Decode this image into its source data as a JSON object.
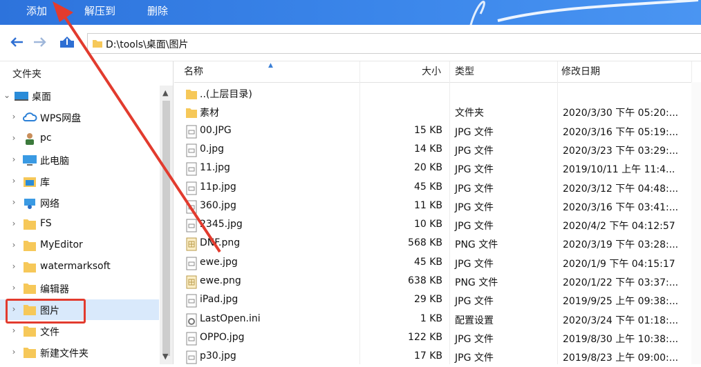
{
  "toolbar": {
    "add": "添加",
    "extract": "解压到",
    "delete": "删除"
  },
  "address": {
    "path": "D:\\tools\\桌面\\图片"
  },
  "left": {
    "header": "文件夹",
    "items": [
      {
        "label": "桌面",
        "icon": "desktop-icon",
        "expanded": true
      },
      {
        "label": "WPS网盘",
        "icon": "cloud-icon"
      },
      {
        "label": "pc",
        "icon": "user-icon"
      },
      {
        "label": "此电脑",
        "icon": "computer-icon"
      },
      {
        "label": "库",
        "icon": "library-icon"
      },
      {
        "label": "网络",
        "icon": "network-icon"
      },
      {
        "label": "FS",
        "icon": "folder-icon"
      },
      {
        "label": "MyEditor",
        "icon": "folder-icon"
      },
      {
        "label": "watermarksoft",
        "icon": "folder-icon"
      },
      {
        "label": "编辑器",
        "icon": "folder-icon"
      },
      {
        "label": "图片",
        "icon": "folder-icon",
        "highlighted": true
      },
      {
        "label": "文件",
        "icon": "folder-icon"
      },
      {
        "label": "新建文件夹",
        "icon": "folder-icon"
      }
    ]
  },
  "columns": {
    "name": "名称",
    "size": "大小",
    "type": "类型",
    "date": "修改日期"
  },
  "files": [
    {
      "name": "..(上层目录)",
      "size": "",
      "type": "",
      "date": "",
      "icon": "folder-icon"
    },
    {
      "name": "素材",
      "size": "",
      "type": "文件夹",
      "date": "2020/3/30 下午 05:20:...",
      "icon": "folder-icon"
    },
    {
      "name": "00.JPG",
      "size": "15 KB",
      "type": "JPG 文件",
      "date": "2020/3/16 下午 05:19:...",
      "icon": "image-file-icon"
    },
    {
      "name": "0.jpg",
      "size": "14 KB",
      "type": "JPG 文件",
      "date": "2020/3/23 下午 03:29:...",
      "icon": "image-file-icon"
    },
    {
      "name": "11.jpg",
      "size": "20 KB",
      "type": "JPG 文件",
      "date": "2019/10/11 上午 11:4...",
      "icon": "image-file-icon"
    },
    {
      "name": "11p.jpg",
      "size": "45 KB",
      "type": "JPG 文件",
      "date": "2020/3/12 下午 04:48:...",
      "icon": "image-file-icon"
    },
    {
      "name": "360.jpg",
      "size": "11 KB",
      "type": "JPG 文件",
      "date": "2020/3/16 下午 03:41:...",
      "icon": "image-file-icon"
    },
    {
      "name": "2345.jpg",
      "size": "10 KB",
      "type": "JPG 文件",
      "date": "2020/4/2 下午 04:12:57",
      "icon": "image-file-icon"
    },
    {
      "name": "DNF.png",
      "size": "568 KB",
      "type": "PNG 文件",
      "date": "2020/3/19 下午 03:28:...",
      "icon": "png-file-icon"
    },
    {
      "name": "ewe.jpg",
      "size": "45 KB",
      "type": "JPG 文件",
      "date": "2020/1/9 下午 04:15:17",
      "icon": "image-file-icon"
    },
    {
      "name": "ewe.png",
      "size": "638 KB",
      "type": "PNG 文件",
      "date": "2020/1/22 下午 03:37:...",
      "icon": "png-file-icon"
    },
    {
      "name": "iPad.jpg",
      "size": "29 KB",
      "type": "JPG 文件",
      "date": "2019/9/25 上午 09:38:...",
      "icon": "image-file-icon"
    },
    {
      "name": "LastOpen.ini",
      "size": "1 KB",
      "type": "配置设置",
      "date": "2020/3/24 下午 01:18:...",
      "icon": "settings-file-icon"
    },
    {
      "name": "OPPO.jpg",
      "size": "122 KB",
      "type": "JPG 文件",
      "date": "2019/8/30 上午 10:38:...",
      "icon": "image-file-icon"
    },
    {
      "name": "p30.jpg",
      "size": "17 KB",
      "type": "JPG 文件",
      "date": "2019/8/23 上午 09:00:...",
      "icon": "image-file-icon"
    }
  ],
  "colors": {
    "toolbar": "#3b86ea",
    "annotation": "#e23b2e",
    "folder": "#f6c859"
  }
}
